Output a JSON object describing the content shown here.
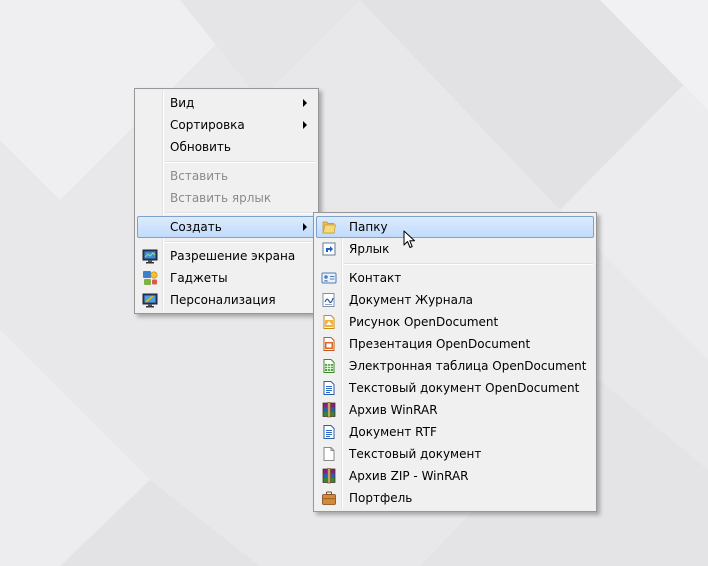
{
  "context_menu": {
    "items": [
      {
        "label": "Вид",
        "submenu": true
      },
      {
        "label": "Сортировка",
        "submenu": true
      },
      {
        "label": "Обновить"
      },
      {
        "label": "Вставить",
        "disabled": true
      },
      {
        "label": "Вставить ярлык",
        "disabled": true
      },
      {
        "label": "Создать",
        "submenu": true,
        "highlighted": true
      },
      {
        "label": "Разрешение экрана",
        "icon": "monitor-icon"
      },
      {
        "label": "Гаджеты",
        "icon": "gadgets-icon"
      },
      {
        "label": "Персонализация",
        "icon": "personalization-icon"
      }
    ]
  },
  "submenu_create": {
    "items": [
      {
        "label": "Папку",
        "icon": "folder-icon",
        "highlighted": true
      },
      {
        "label": "Ярлык",
        "icon": "shortcut-icon"
      },
      {
        "label": "Контакт",
        "icon": "contact-icon"
      },
      {
        "label": "Документ Журнала",
        "icon": "journal-icon"
      },
      {
        "label": "Рисунок OpenDocument",
        "icon": "odg-icon"
      },
      {
        "label": "Презентация OpenDocument",
        "icon": "odp-icon"
      },
      {
        "label": "Электронная таблица OpenDocument",
        "icon": "ods-icon"
      },
      {
        "label": "Текстовый документ OpenDocument",
        "icon": "odt-icon"
      },
      {
        "label": "Архив WinRAR",
        "icon": "winrar-icon"
      },
      {
        "label": "Документ RTF",
        "icon": "rtf-icon"
      },
      {
        "label": "Текстовый документ",
        "icon": "txt-icon"
      },
      {
        "label": "Архив ZIP - WinRAR",
        "icon": "zip-icon"
      },
      {
        "label": "Портфель",
        "icon": "briefcase-icon"
      }
    ]
  },
  "colors": {
    "highlight": "#cde1fa",
    "highlight_border": "#7da2ce",
    "menu_bg": "#f0f0f0",
    "disabled_text": "#8b8b8b"
  }
}
